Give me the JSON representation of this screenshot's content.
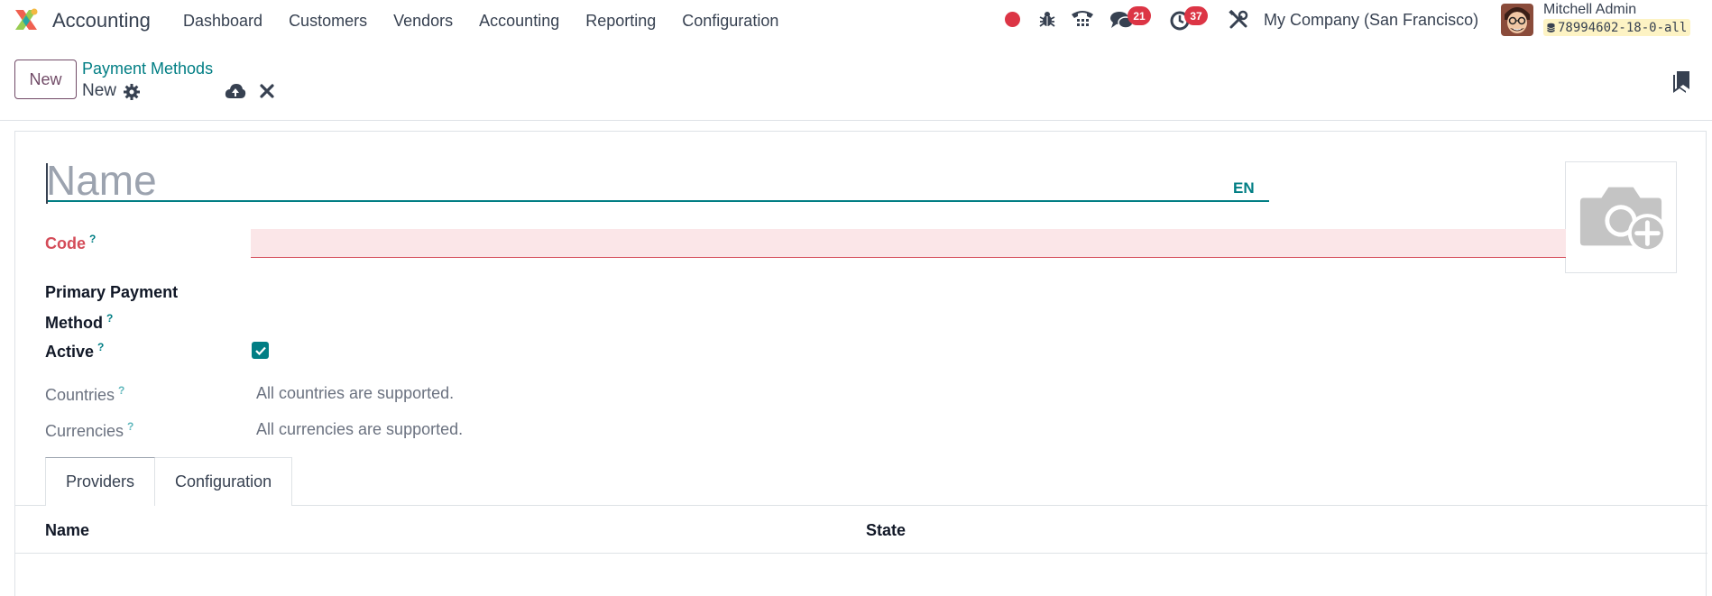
{
  "app": {
    "name": "Accounting",
    "menu": [
      "Dashboard",
      "Customers",
      "Vendors",
      "Accounting",
      "Reporting",
      "Configuration"
    ]
  },
  "systray": {
    "messages_count": "21",
    "activities_count": "37",
    "company": "My Company (San Francisco)",
    "user_name": "Mitchell Admin",
    "database": "78994602-18-0-all"
  },
  "control_panel": {
    "new_label": "New",
    "breadcrumb": "Payment Methods",
    "record_name": "New"
  },
  "form": {
    "name_placeholder": "Name",
    "lang": "EN",
    "fields": {
      "code_label": "Code",
      "primary_payment_method_label": "Primary Payment Method",
      "active_label": "Active",
      "countries_label": "Countries",
      "currencies_label": "Currencies",
      "help_mark": "?"
    },
    "values": {
      "active": true,
      "countries": "All countries are supported.",
      "currencies": "All currencies are supported."
    },
    "tabs": [
      "Providers",
      "Configuration"
    ],
    "active_tab": "Providers",
    "list_columns": [
      "Name",
      "State"
    ]
  },
  "colors": {
    "primary": "#714b67",
    "accent": "#017e84",
    "danger": "#dc3545",
    "invalid_bg": "#fbe6e8"
  },
  "icons": [
    "app-logo-icon",
    "record-dot-icon",
    "bug-icon",
    "phone-icon",
    "chat-icon",
    "clock-icon",
    "tools-icon",
    "database-icon",
    "gear-icon",
    "cloud-upload-icon",
    "close-icon",
    "bookmark-icon",
    "camera-plus-icon",
    "check-icon"
  ]
}
